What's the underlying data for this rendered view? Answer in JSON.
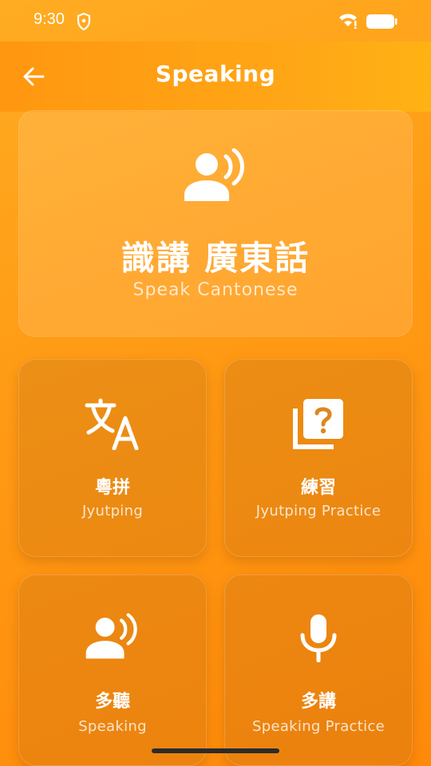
{
  "status_bar": {
    "time": "9:30"
  },
  "header": {
    "title": "Speaking"
  },
  "hero": {
    "title": "識講 廣東話",
    "subtitle": "Speak Cantonese"
  },
  "cards": [
    {
      "label_cn": "粵拼",
      "label_en": "Jyutping",
      "icon": "translate-icon"
    },
    {
      "label_cn": "練習",
      "label_en": "Jyutping Practice",
      "icon": "quiz-icon"
    },
    {
      "label_cn": "多聽",
      "label_en": "Speaking",
      "icon": "record-voice-icon"
    },
    {
      "label_cn": "多講",
      "label_en": "Speaking Practice",
      "icon": "microphone-icon"
    }
  ],
  "colors": {
    "accent": "#ff9a14",
    "text": "#ffffff"
  }
}
